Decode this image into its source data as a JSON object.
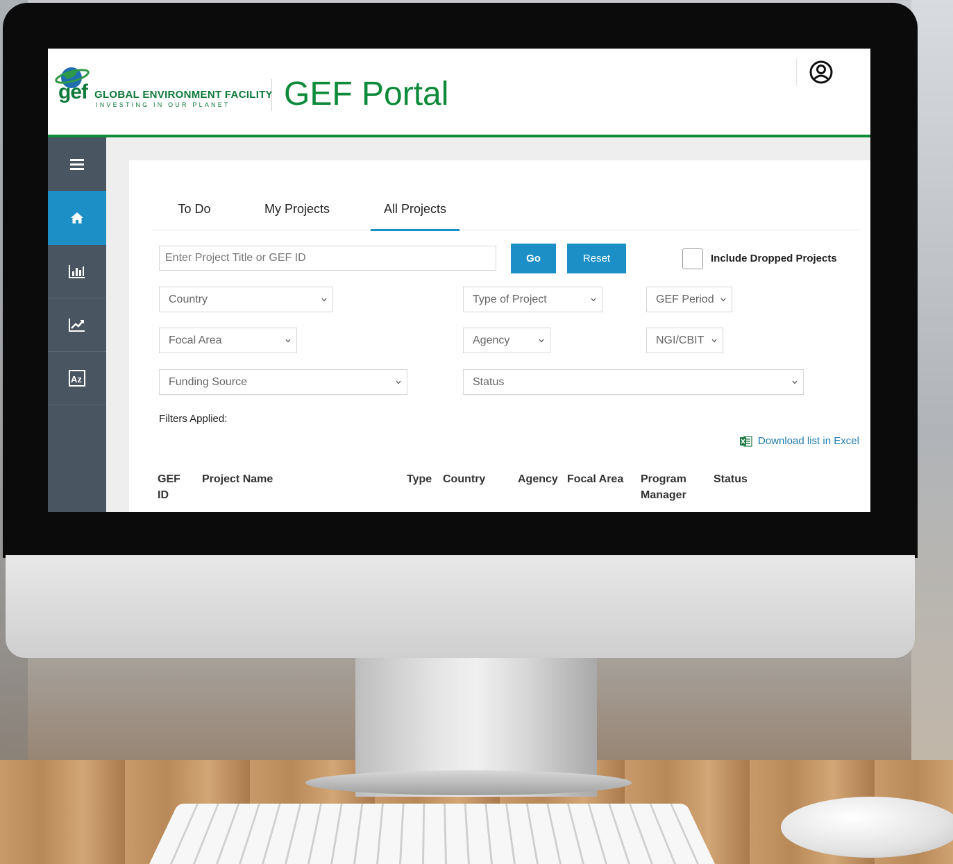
{
  "header": {
    "logo_text": "gef",
    "org_name": "GLOBAL ENVIRONMENT FACILITY",
    "tagline": "INVESTING IN OUR PLANET",
    "title": "GEF Portal",
    "brand_color": "#0d8a3a"
  },
  "sidebar": {
    "accent_color": "#1d8fc7",
    "items": [
      {
        "icon": "menu-icon"
      },
      {
        "icon": "home-icon",
        "active": true
      },
      {
        "icon": "bar-chart-icon"
      },
      {
        "icon": "line-chart-icon"
      },
      {
        "icon": "az-sort-icon"
      }
    ]
  },
  "tabs": [
    {
      "label": "To Do"
    },
    {
      "label": "My Projects"
    },
    {
      "label": "All Projects",
      "active": true
    }
  ],
  "search": {
    "placeholder": "Enter Project Title or GEF ID",
    "go_label": "Go",
    "reset_label": "Reset",
    "dropped_label": "Include Dropped Projects"
  },
  "filters": {
    "country": "Country",
    "type_of_project": "Type of Project",
    "gef_period": "GEF Period",
    "focal_area": "Focal Area",
    "agency": "Agency",
    "ngi_cbit": "NGI/CBIT",
    "funding_source": "Funding Source",
    "status": "Status"
  },
  "filters_applied_label": "Filters Applied:",
  "download_label": "Download list in Excel",
  "table": {
    "columns": {
      "gef_id_1": "GEF",
      "gef_id_2": "ID",
      "project_name": "Project Name",
      "type": "Type",
      "country": "Country",
      "agency": "Agency",
      "focal_area": "Focal Area",
      "program_manager_1": "Program",
      "program_manager_2": "Manager",
      "status": "Status"
    }
  }
}
